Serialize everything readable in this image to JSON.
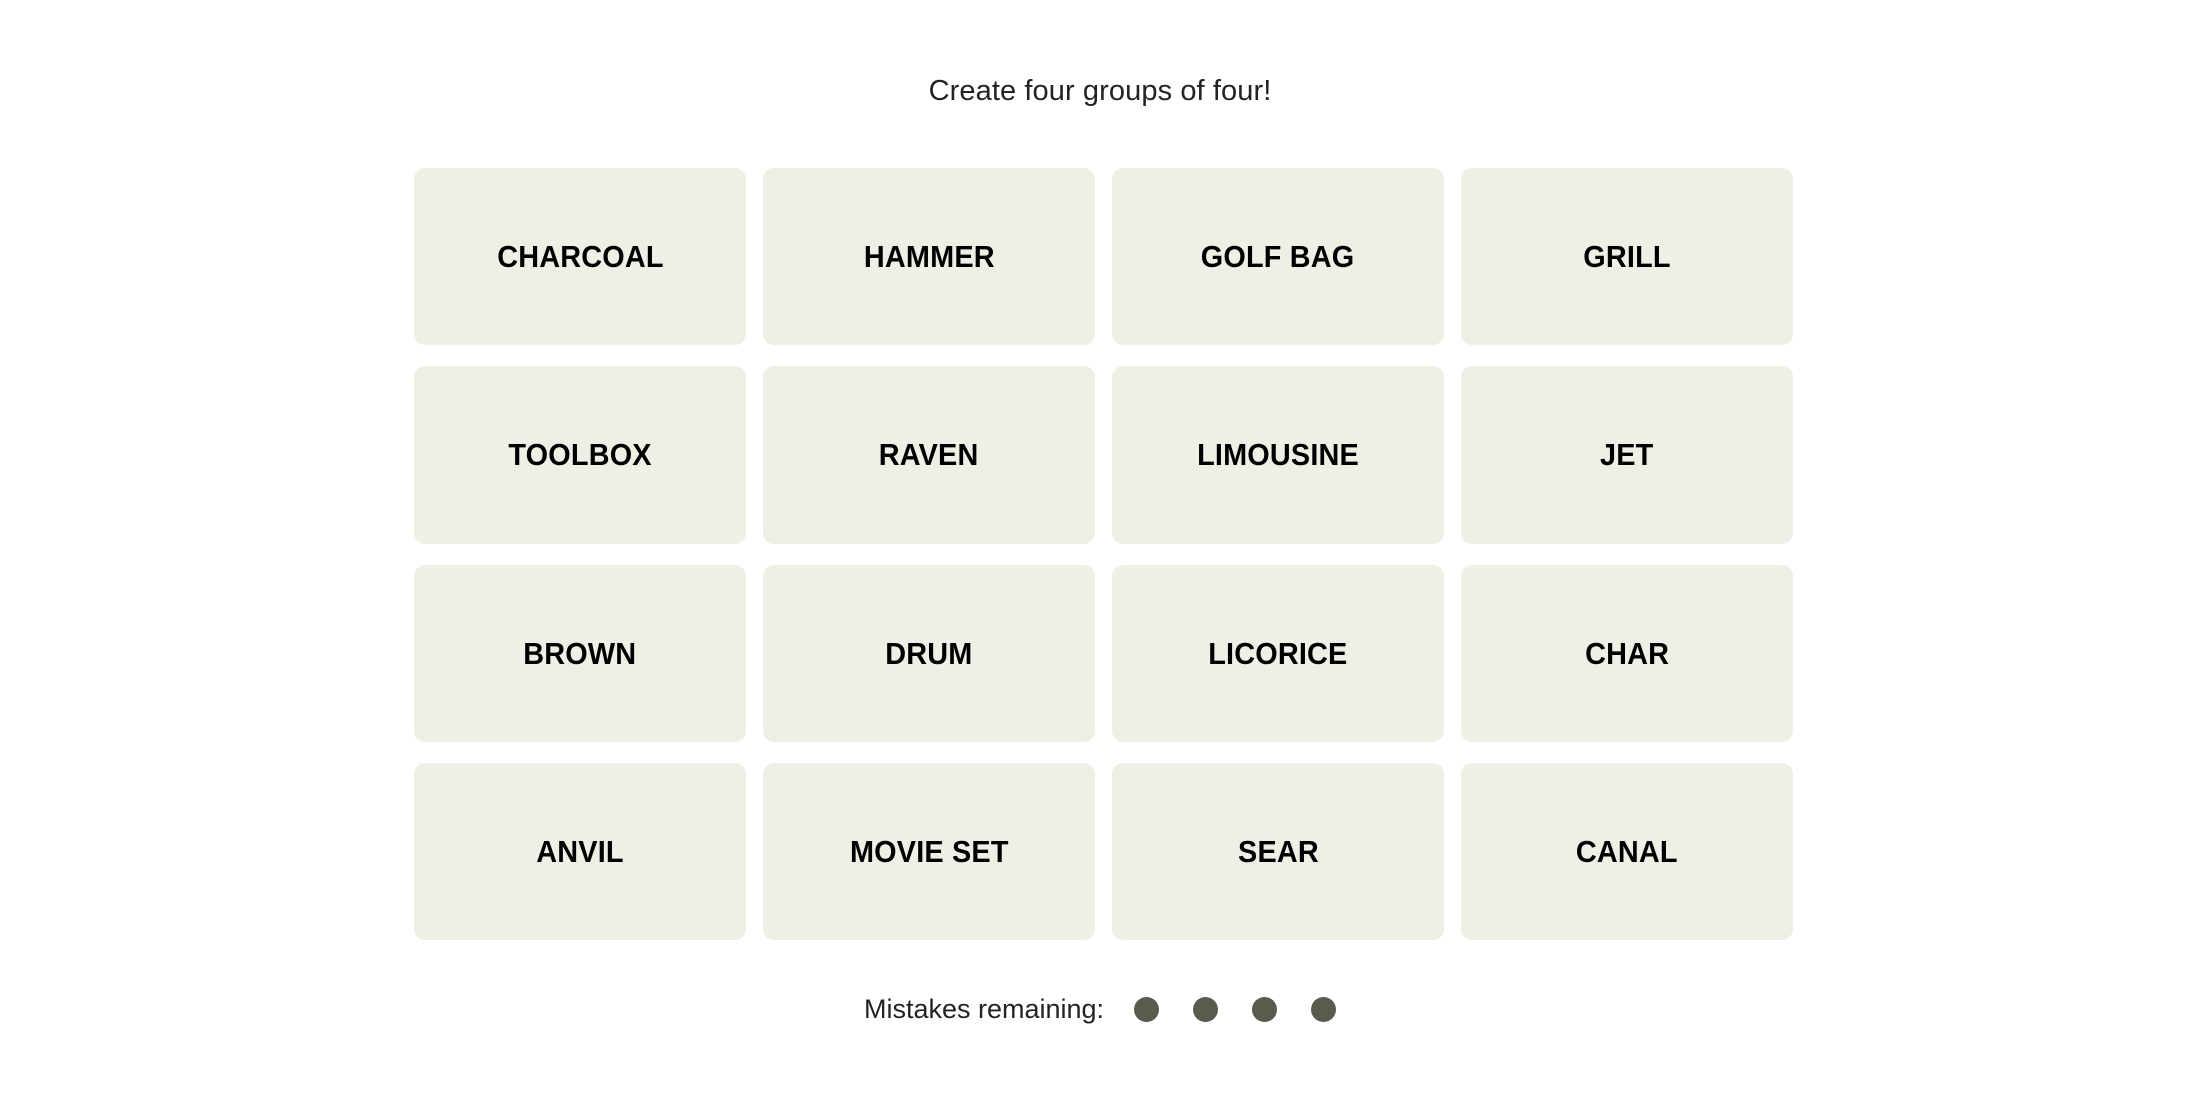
{
  "page": {
    "background_color": "#ffffff"
  },
  "header": {
    "title": "Create four groups of four!"
  },
  "board": {
    "tile_background_color": "#efefe6",
    "tile_text_color": "#000000",
    "rows": [
      {
        "tiles": [
          "CHARCOAL",
          "HAMMER",
          "GOLF BAG",
          "GRILL"
        ]
      },
      {
        "tiles": [
          "TOOLBOX",
          "RAVEN",
          "LIMOUSINE",
          "JET"
        ]
      },
      {
        "tiles": [
          "BROWN",
          "DRUM",
          "LICORICE",
          "CHAR"
        ]
      },
      {
        "tiles": [
          "ANVIL",
          "MOVIE SET",
          "SEAR",
          "CANAL"
        ]
      }
    ]
  },
  "footer": {
    "mistakes_label": "Mistakes remaining:",
    "mistakes_remaining": 4,
    "dot_color": "#5a5a4d"
  }
}
